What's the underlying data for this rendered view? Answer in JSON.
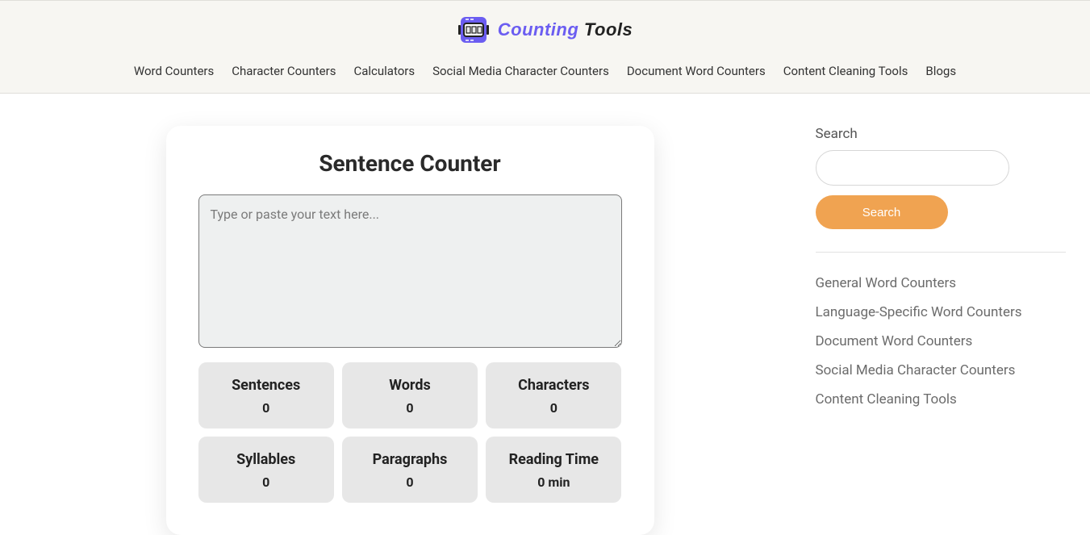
{
  "logo": {
    "counting": "Counting",
    "tools": " Tools"
  },
  "nav": [
    "Word Counters",
    "Character Counters",
    "Calculators",
    "Social Media Character Counters",
    "Document Word Counters",
    "Content Cleaning Tools",
    "Blogs"
  ],
  "card": {
    "title": "Sentence Counter",
    "placeholder": "Type or paste your text here...",
    "stats": [
      {
        "label": "Sentences",
        "value": "0"
      },
      {
        "label": "Words",
        "value": "0"
      },
      {
        "label": "Characters",
        "value": "0"
      },
      {
        "label": "Syllables",
        "value": "0"
      },
      {
        "label": "Paragraphs",
        "value": "0"
      },
      {
        "label": "Reading Time",
        "value": "0 min"
      }
    ]
  },
  "sidebar": {
    "search_label": "Search",
    "search_button": "Search",
    "links": [
      "General Word Counters",
      "Language-Specific Word Counters",
      "Document Word Counters",
      "Social Media Character Counters",
      "Content Cleaning Tools"
    ]
  }
}
